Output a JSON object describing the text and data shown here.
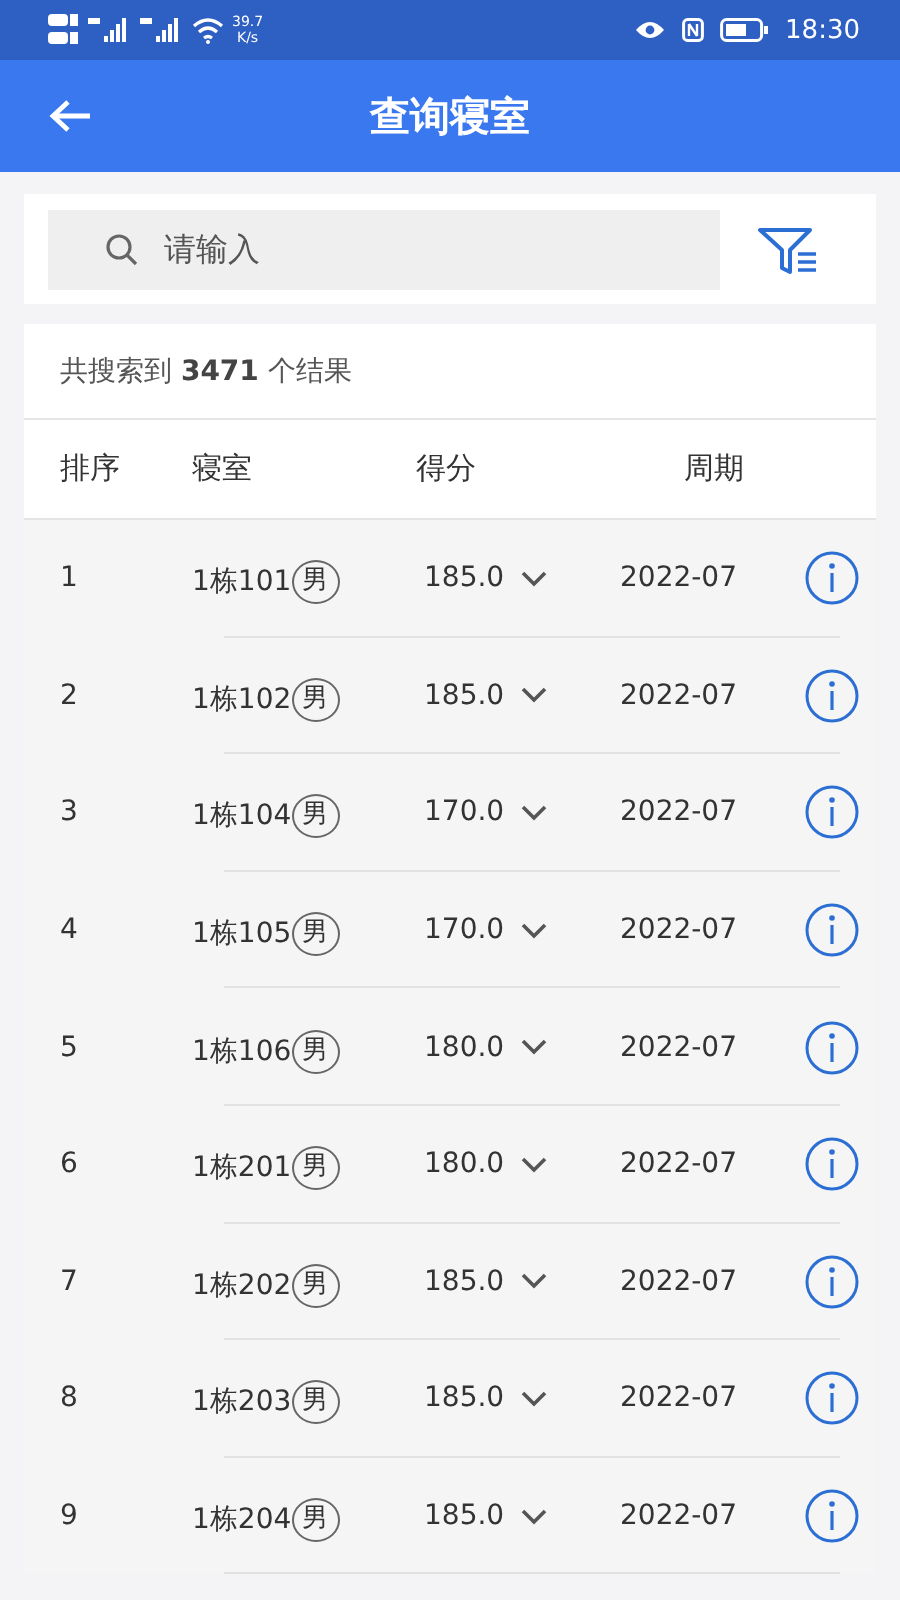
{
  "status_bar": {
    "speed": "39.7",
    "speed_unit": "K/s",
    "time": "18:30"
  },
  "header": {
    "title": "查询寝室"
  },
  "search": {
    "placeholder": "请输入"
  },
  "result_count": "共搜索到 **3471** 个结果",
  "table": {
    "columns": [
      "排序",
      "寝室",
      "得分",
      "周期"
    ],
    "rows": [
      {
        "rank": "1",
        "room": "1栋101",
        "gender": "男",
        "score": "185.0",
        "period": "2022-07"
      },
      {
        "rank": "2",
        "room": "1栋102",
        "gender": "男",
        "score": "185.0",
        "period": "2022-07"
      },
      {
        "rank": "3",
        "room": "1栋104",
        "gender": "男",
        "score": "170.0",
        "period": "2022-07"
      },
      {
        "rank": "4",
        "room": "1栋105",
        "gender": "男",
        "score": "170.0",
        "period": "2022-07"
      },
      {
        "rank": "5",
        "room": "1栋106",
        "gender": "男",
        "score": "180.0",
        "period": "2022-07"
      },
      {
        "rank": "6",
        "room": "1栋201",
        "gender": "男",
        "score": "180.0",
        "period": "2022-07"
      },
      {
        "rank": "7",
        "room": "1栋202",
        "gender": "男",
        "score": "185.0",
        "period": "2022-07"
      },
      {
        "rank": "8",
        "room": "1栋203",
        "gender": "男",
        "score": "185.0",
        "period": "2022-07"
      },
      {
        "rank": "9",
        "room": "1栋204",
        "gender": "男",
        "score": "185.0",
        "period": "2022-07"
      }
    ]
  }
}
